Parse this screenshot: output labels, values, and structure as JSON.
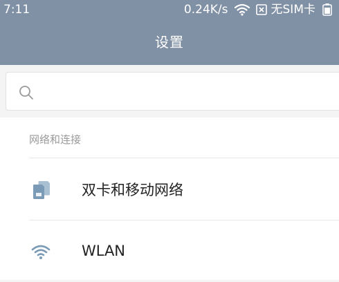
{
  "status_bar": {
    "time": "7:11",
    "net_speed": "0.24K/s",
    "sim_status": "无SIM卡",
    "icons": [
      "wifi-icon",
      "sim-x-icon",
      "battery-icon"
    ]
  },
  "header": {
    "title": "设置"
  },
  "search": {
    "placeholder": "",
    "value": ""
  },
  "sections": [
    {
      "header": "网络和连接",
      "items": [
        {
          "label": "双卡和移动网络",
          "icon": "dual-sim-icon",
          "value": ""
        },
        {
          "label": "WLAN",
          "icon": "wifi-icon",
          "value": ""
        }
      ]
    }
  ],
  "colors": {
    "header_bg": "#8090a5",
    "icon_color": "#7a9ab5",
    "page_bg": "#f4f4f4",
    "divider": "#e6e6e6",
    "section_header_text": "#9a9a9a"
  }
}
